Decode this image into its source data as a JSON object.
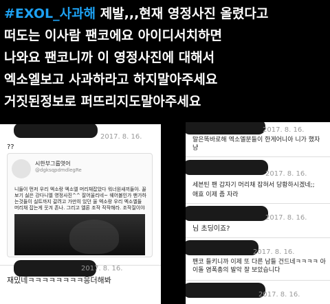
{
  "tweet": {
    "hashtag": "#EXOL_사과해",
    "line1_rest": " 제발,,,현재 영정사진 올렸다고",
    "line2": "떠도는 이사람 팬코에요 아이디서치하면",
    "line3": "나와요 팬코니까 이 영정사진에 대해서",
    "line4": "엑소엘보고 사과하라고 하지말아주세요",
    "line5": "거짓된정보로 퍼뜨리지도말아주세요"
  },
  "left_shot": {
    "date_top": "2017. 8. 16.",
    "question": "??",
    "profile_name": "시한부그룹엿어",
    "profile_handle": "@dgksqpdmdlegRe",
    "post_text": "니들이 먼저 우리 엑소랑 엑소엘 머리채잡았다 워너원새끼들아. 꼴보기 싫은 강다니엘 영정사진^^ 잘어울리네~ 웨어볼인가 팬가하는것들이 실트까지 갈려고 가만히 있던 울 엑소랑 우리 엑소엘들 머리채 잡는게 웃겨 존나. 그리고 엘론 조작 작작해라. 조작질이야",
    "date_bottom": "2017. 8. 16.",
    "reply": "재밌네ㅋㅋㅋㅋㅋㅋㅋㅋ응더해봐"
  },
  "right_shot": {
    "date1": "2017. 8. 16.",
    "msg1": "말은똑바로해 엑소엘분들이 한게어니아 니가 했자냥",
    "date2": "2017. 8. 16.",
    "msg2a": "세븐틴 팬 갑자기 머리채 잡혀서 당황하시겠네;;",
    "msg2b": "애효 이제 좀 자라",
    "date3": "2017. 8. 16.",
    "msg3": "님 초딩이죠?",
    "date4": "2017. 8. 16.",
    "msg4": "팬코 들키니까 이제 또 다른 남들 건드네ㅋㅋㅋㅋ 아이돌 염폭총의 발악 잘 보았습니다",
    "date5": "2017. 8. 16."
  }
}
